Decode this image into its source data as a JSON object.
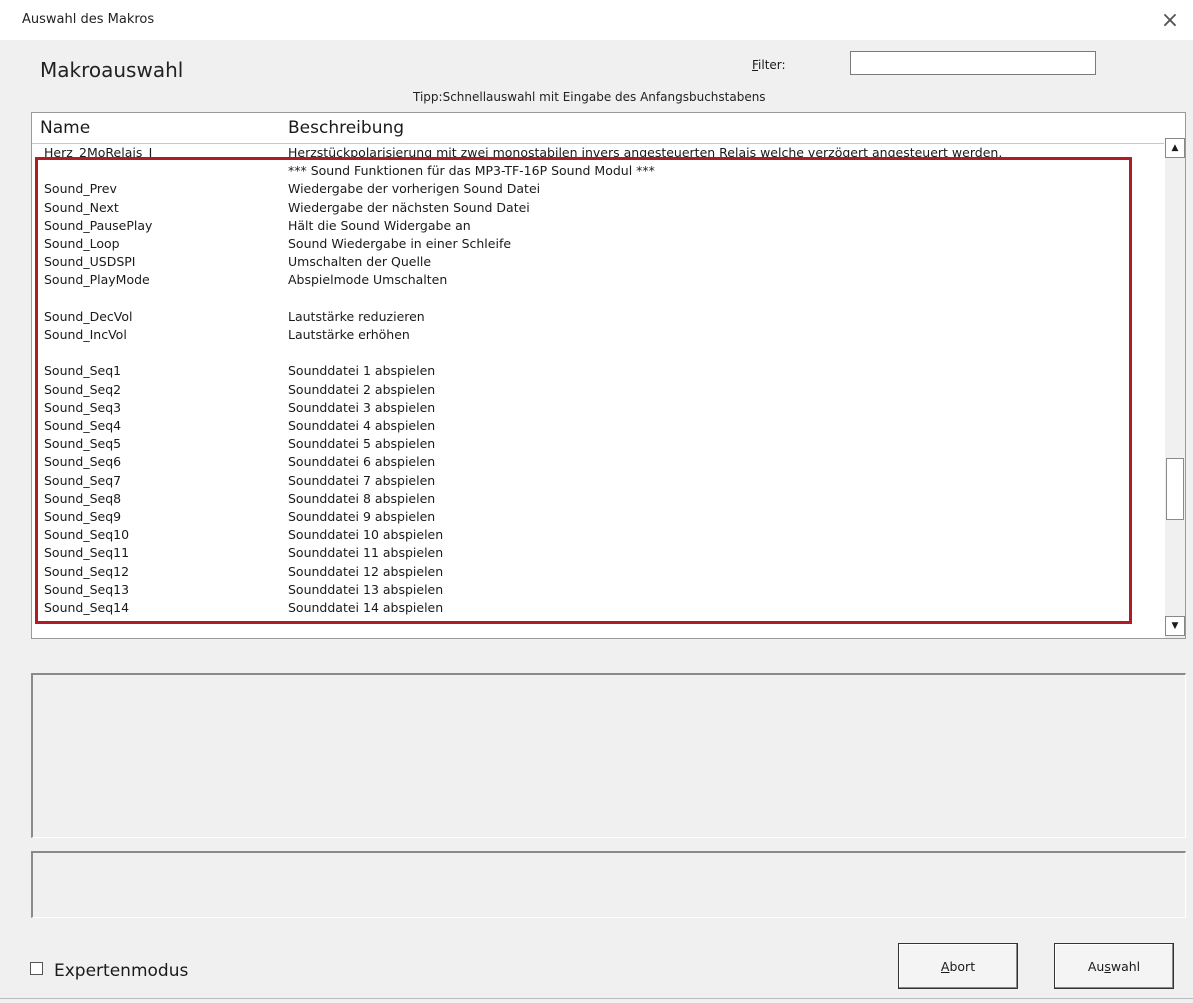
{
  "window": {
    "title": "Auswahl des Makros",
    "close_glyph": "×"
  },
  "header": {
    "title": "Makroauswahl",
    "filter_label_mnemonic": "F",
    "filter_label_rest": "ilter:",
    "filter_value": "",
    "tip": "Tipp:Schnellauswahl mit Eingabe des Anfangsbuchstabens"
  },
  "list": {
    "columns": {
      "name": "Name",
      "description": "Beschreibung"
    },
    "rows": [
      {
        "name": "Herz_2MoRelais_I",
        "desc": "Herzstückpolarisierung mit zwei monostabilen invers angesteuerten Relais welche verzögert angesteuert werden."
      },
      {
        "name": "",
        "desc": "*** Sound Funktionen für das MP3-TF-16P Sound Modul ***"
      },
      {
        "name": "Sound_Prev",
        "desc": "Wiedergabe der vorherigen Sound Datei"
      },
      {
        "name": "Sound_Next",
        "desc": "Wiedergabe der nächsten Sound Datei"
      },
      {
        "name": "Sound_PausePlay",
        "desc": "Hält die Sound Widergabe an"
      },
      {
        "name": "Sound_Loop",
        "desc": "Sound Wiedergabe in einer Schleife"
      },
      {
        "name": "Sound_USDSPI",
        "desc": "Umschalten der Quelle"
      },
      {
        "name": "Sound_PlayMode",
        "desc": "Abspielmode Umschalten"
      },
      {
        "name": "",
        "desc": ""
      },
      {
        "name": "Sound_DecVol",
        "desc": "Lautstärke reduzieren"
      },
      {
        "name": "Sound_IncVol",
        "desc": "Lautstärke erhöhen"
      },
      {
        "name": "",
        "desc": ""
      },
      {
        "name": "Sound_Seq1",
        "desc": "Sounddatei 1 abspielen"
      },
      {
        "name": "Sound_Seq2",
        "desc": "Sounddatei 2 abspielen"
      },
      {
        "name": "Sound_Seq3",
        "desc": "Sounddatei 3 abspielen"
      },
      {
        "name": "Sound_Seq4",
        "desc": "Sounddatei 4 abspielen"
      },
      {
        "name": "Sound_Seq5",
        "desc": "Sounddatei 5 abspielen"
      },
      {
        "name": "Sound_Seq6",
        "desc": "Sounddatei 6 abspielen"
      },
      {
        "name": "Sound_Seq7",
        "desc": "Sounddatei 7 abspielen"
      },
      {
        "name": "Sound_Seq8",
        "desc": "Sounddatei 8 abspielen"
      },
      {
        "name": "Sound_Seq9",
        "desc": "Sounddatei 9 abspielen"
      },
      {
        "name": "Sound_Seq10",
        "desc": "Sounddatei 10 abspielen"
      },
      {
        "name": "Sound_Seq11",
        "desc": "Sounddatei 11 abspielen"
      },
      {
        "name": "Sound_Seq12",
        "desc": "Sounddatei 12 abspielen"
      },
      {
        "name": "Sound_Seq13",
        "desc": "Sounddatei 13 abspielen"
      },
      {
        "name": "Sound_Seq14",
        "desc": "Sounddatei 14 abspielen"
      }
    ],
    "highlight_color": "#b01c23",
    "scroll_up_glyph": "▲",
    "scroll_down_glyph": "▼"
  },
  "footer": {
    "expert_mode_label": "Expertenmodus",
    "expert_mode_checked": false,
    "abort_mnemonic": "A",
    "abort_rest": "bort",
    "select_pre": "Au",
    "select_mnemonic": "s",
    "select_post": "wahl"
  }
}
